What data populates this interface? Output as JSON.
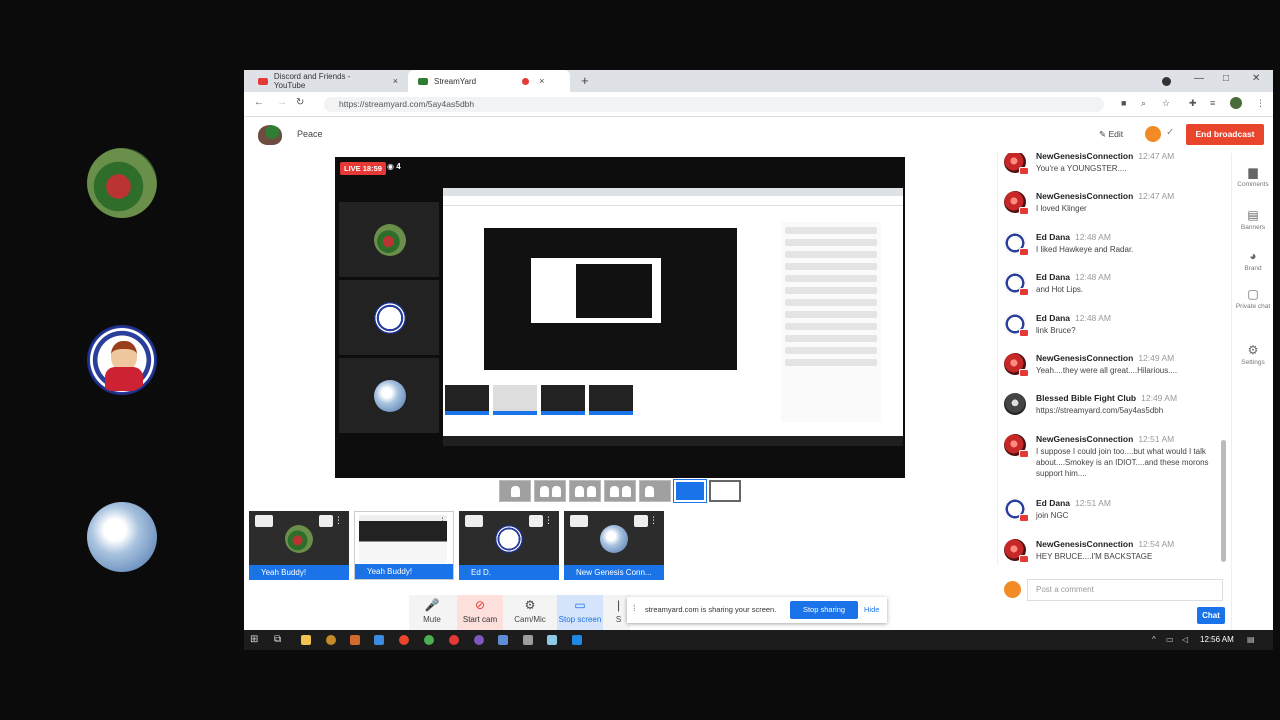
{
  "browser": {
    "tabs": [
      {
        "title": "Discord and Friends - YouTube",
        "close": "×"
      },
      {
        "title": "StreamYard",
        "close": "×"
      }
    ],
    "new_tab": "+",
    "url": "https://streamyard.com/5ay4as5dbh",
    "controls": {
      "minimize": "—",
      "maximize": "□",
      "close": "✕"
    }
  },
  "header": {
    "broadcast_title": "Peace",
    "edit_label": "Edit",
    "end_label": "End broadcast"
  },
  "stage": {
    "live_label": "LIVE 18:59",
    "viewers": "4"
  },
  "participants": [
    {
      "name": "Yeah Buddy!"
    },
    {
      "name": "Yeah Buddy!"
    },
    {
      "name": "Ed D."
    },
    {
      "name": "New Genesis Conn..."
    }
  ],
  "toolbar": {
    "mute": "Mute",
    "start_cam": "Start cam",
    "cam_mic": "Cam/Mic",
    "stop_screen": "Stop screen",
    "more": "S"
  },
  "share_notice": {
    "text": "streamyard.com is sharing your screen.",
    "stop": "Stop sharing",
    "hide": "Hide"
  },
  "comments": [
    {
      "author": "NewGenesisConnection",
      "time": "12:47 AM",
      "text": "You're a YOUNGSTER...."
    },
    {
      "author": "NewGenesisConnection",
      "time": "12:47 AM",
      "text": "I loved Klinger"
    },
    {
      "author": "Ed Dana",
      "time": "12:48 AM",
      "text": "I liked Hawkeye and Radar."
    },
    {
      "author": "Ed Dana",
      "time": "12:48 AM",
      "text": "and Hot Lips."
    },
    {
      "author": "Ed Dana",
      "time": "12:48 AM",
      "text": "link Bruce?"
    },
    {
      "author": "NewGenesisConnection",
      "time": "12:49 AM",
      "text": "Yeah....they were all great....Hilarious...."
    },
    {
      "author": "Blessed Bible Fight Club",
      "time": "12:49 AM",
      "text": "https://streamyard.com/5ay4as5dbh"
    },
    {
      "author": "NewGenesisConnection",
      "time": "12:51 AM",
      "text": "I suppose I could join too....but what would I talk about....Smokey is an IDIOT....and these morons support him...."
    },
    {
      "author": "Ed Dana",
      "time": "12:51 AM",
      "text": "join NGC"
    },
    {
      "author": "NewGenesisConnection",
      "time": "12:54 AM",
      "text": "HEY BRUCE....I'M BACKSTAGE"
    }
  ],
  "comment_input": {
    "placeholder": "Post a comment"
  },
  "chat_button": "Chat",
  "rail": [
    {
      "label": "Comments",
      "icon": "comment-icon"
    },
    {
      "label": "Banners",
      "icon": "banner-icon"
    },
    {
      "label": "Brand",
      "icon": "palette-icon"
    },
    {
      "label": "Private chat",
      "icon": "private-chat-icon"
    },
    {
      "label": "Settings",
      "icon": "gear-icon"
    }
  ],
  "system": {
    "clock": "12:56 AM"
  }
}
